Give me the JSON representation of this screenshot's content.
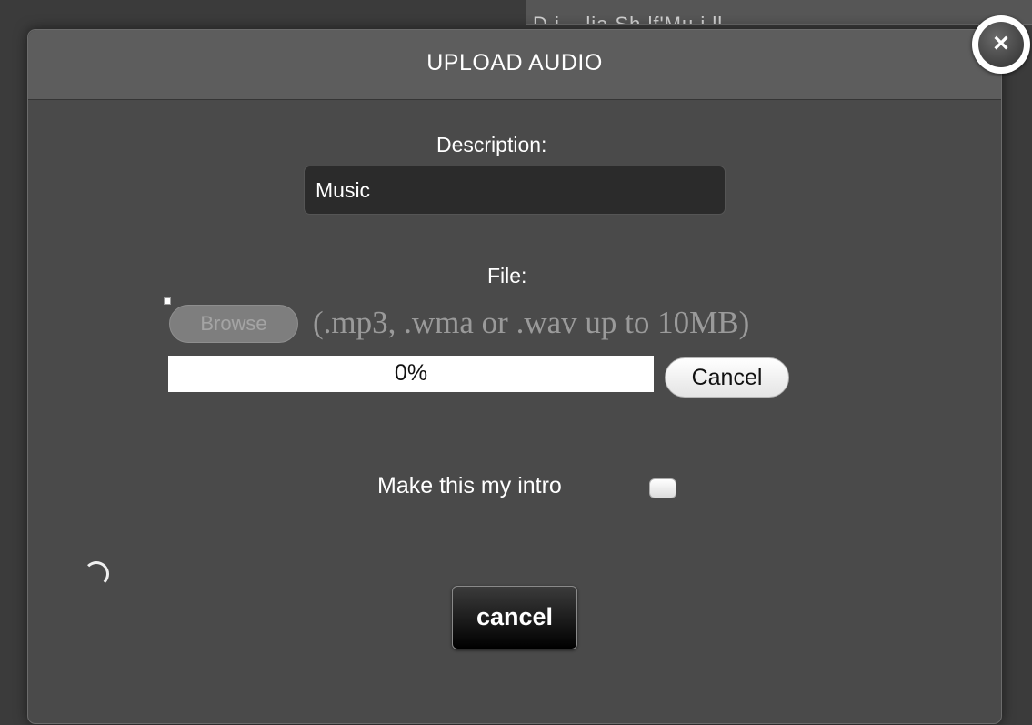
{
  "background": {
    "strip_text": "D       i        ..   lia Sh lf'Mu   i  ll"
  },
  "dialog": {
    "title": "UPLOAD AUDIO",
    "close_label": "×"
  },
  "description": {
    "label": "Description:",
    "value": "Music"
  },
  "file": {
    "label": "File:",
    "browse_label": "Browse",
    "hint": "(.mp3, .wma or .wav up to 10MB)"
  },
  "upload_progress": {
    "text": "0%",
    "fraction": 0.0,
    "cancel_label": "Cancel"
  },
  "intro": {
    "label": "Make this my intro",
    "checked": false
  },
  "footer": {
    "cancel_label": "cancel"
  },
  "colors": {
    "dialog_bg": "#4a4a4a",
    "header_bg": "#5d5d5d",
    "input_bg": "#2b2b2b",
    "text": "#ffffff",
    "hint_text": "#9a9a9a"
  }
}
